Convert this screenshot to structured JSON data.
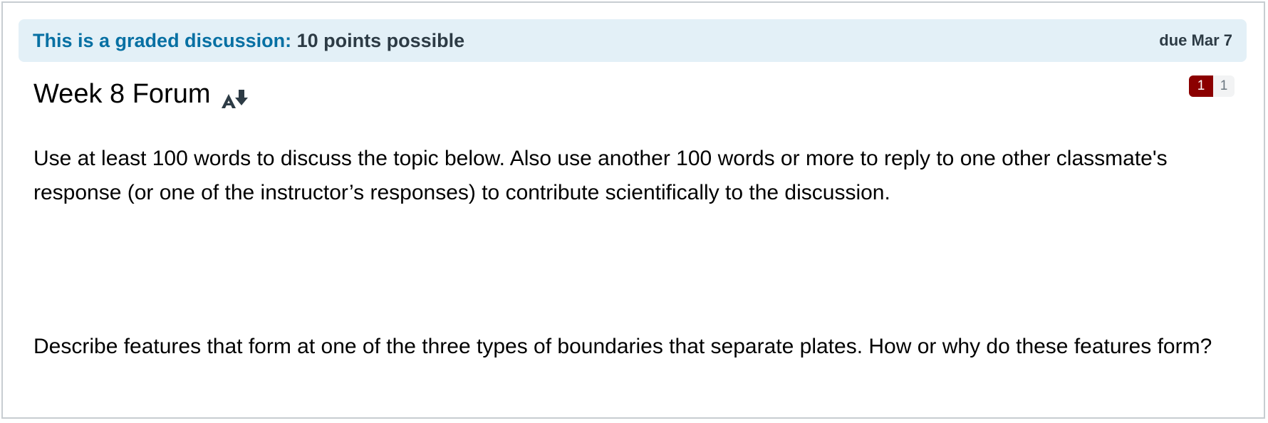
{
  "banner": {
    "label": "This is a graded discussion:",
    "points": "10 points possible",
    "due": "due Mar 7"
  },
  "topic": {
    "title": "Week 8 Forum",
    "accessibility_icon": "alternative-formats-download-icon"
  },
  "unread": {
    "unread_count": "1",
    "total_count": "1"
  },
  "content": {
    "paragraph_1": "Use at least 100 words to discuss the topic below. Also use another 100 words or more to reply to one other classmate's response (or one of the instructor’s responses) to contribute scientifically to the discussion.",
    "paragraph_2": "Describe features that form at one of the three types of boundaries that separate plates. How or why do these features form?"
  },
  "colors": {
    "banner_bg": "#e3f0f7",
    "banner_label": "#0770a3",
    "badge_unread": "#8b0000",
    "text": "#2d3b45"
  }
}
